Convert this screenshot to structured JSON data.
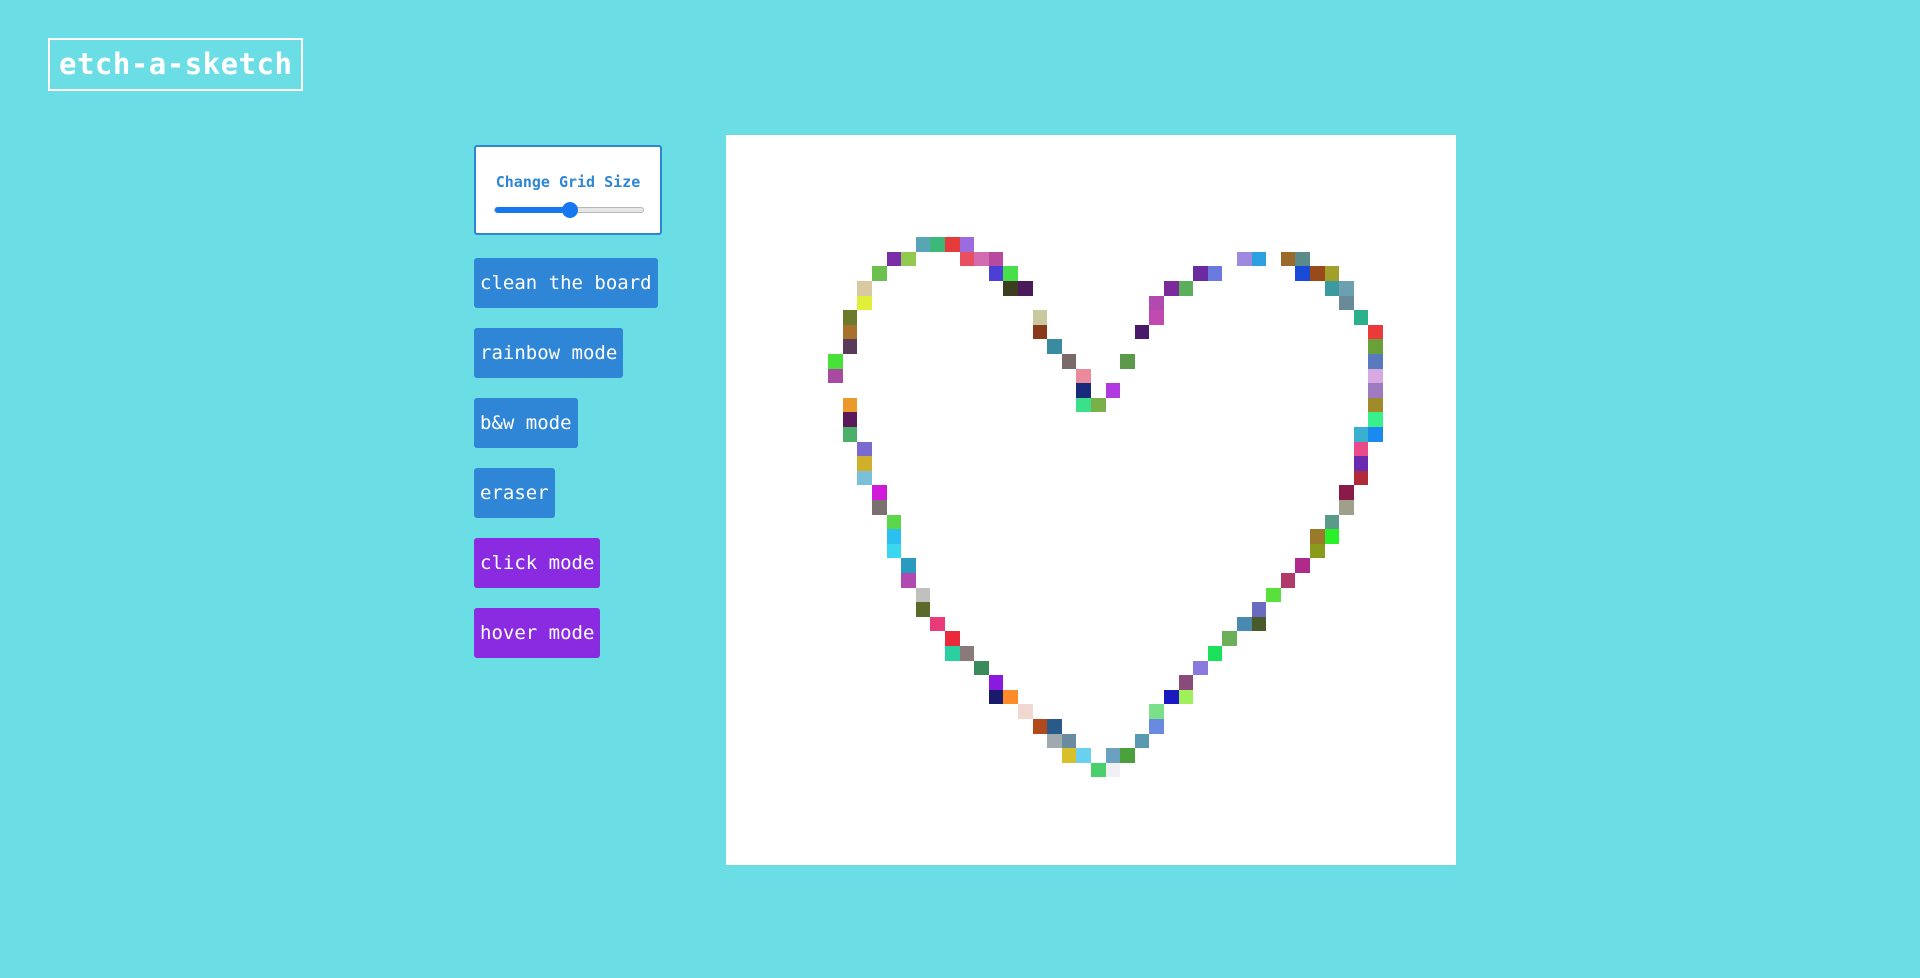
{
  "app": {
    "title": "etch-a-sketch"
  },
  "controls": {
    "grid_size_label": "Change Grid Size",
    "grid_size_slider_fraction": 0.5,
    "buttons": {
      "clean": "clean the board",
      "rainbow": "rainbow mode",
      "bw": "b&w mode",
      "eraser": "eraser",
      "click": "click mode",
      "hover": "hover mode"
    }
  },
  "colors": {
    "page_background": "#6adde5",
    "primary_button": "#2f86d6",
    "mode_button": "#8a2be2",
    "board_background": "#ffffff"
  },
  "board": {
    "grid_size": 50,
    "painted_cells": [
      {
        "c": 13,
        "r": 7,
        "color": "#5aa5b5"
      },
      {
        "c": 14,
        "r": 7,
        "color": "#3cb878"
      },
      {
        "c": 15,
        "r": 7,
        "color": "#e53b3b"
      },
      {
        "c": 16,
        "r": 7,
        "color": "#9c6be0"
      },
      {
        "c": 11,
        "r": 8,
        "color": "#7a2fa8"
      },
      {
        "c": 12,
        "r": 8,
        "color": "#93c94f"
      },
      {
        "c": 16,
        "r": 8,
        "color": "#ea4f5f"
      },
      {
        "c": 17,
        "r": 8,
        "color": "#d36bb0"
      },
      {
        "c": 18,
        "r": 8,
        "color": "#b54aa0"
      },
      {
        "c": 10,
        "r": 9,
        "color": "#6cc04f"
      },
      {
        "c": 18,
        "r": 9,
        "color": "#4b3fd8"
      },
      {
        "c": 19,
        "r": 9,
        "color": "#48e04a"
      },
      {
        "c": 9,
        "r": 10,
        "color": "#d9c9a0"
      },
      {
        "c": 19,
        "r": 10,
        "color": "#3d3d20"
      },
      {
        "c": 20,
        "r": 10,
        "color": "#4a1a5a"
      },
      {
        "c": 9,
        "r": 11,
        "color": "#e0f03a"
      },
      {
        "c": 8,
        "r": 12,
        "color": "#6b7a2a"
      },
      {
        "c": 21,
        "r": 12,
        "color": "#c9c9a0"
      },
      {
        "c": 8,
        "r": 13,
        "color": "#a8702a"
      },
      {
        "c": 21,
        "r": 13,
        "color": "#8a3a1a"
      },
      {
        "c": 8,
        "r": 14,
        "color": "#5a3a5a"
      },
      {
        "c": 22,
        "r": 14,
        "color": "#3a8aa0"
      },
      {
        "c": 7,
        "r": 15,
        "color": "#4ae03a"
      },
      {
        "c": 23,
        "r": 15,
        "color": "#7a6a6a"
      },
      {
        "c": 27,
        "r": 15,
        "color": "#5a9a4a"
      },
      {
        "c": 7,
        "r": 16,
        "color": "#a84aa0"
      },
      {
        "c": 24,
        "r": 16,
        "color": "#ea8a9a"
      },
      {
        "c": 24,
        "r": 17,
        "color": "#1a2a7a"
      },
      {
        "c": 26,
        "r": 17,
        "color": "#b03ae0"
      },
      {
        "c": 8,
        "r": 18,
        "color": "#ea9a2a"
      },
      {
        "c": 24,
        "r": 18,
        "color": "#3ae08a"
      },
      {
        "c": 25,
        "r": 18,
        "color": "#7ab04a"
      },
      {
        "c": 8,
        "r": 19,
        "color": "#5a1a5a"
      },
      {
        "c": 8,
        "r": 20,
        "color": "#4ab06a"
      },
      {
        "c": 9,
        "r": 21,
        "color": "#7a6ad0"
      },
      {
        "c": 9,
        "r": 22,
        "color": "#d0b02a"
      },
      {
        "c": 9,
        "r": 23,
        "color": "#7ac0d8"
      },
      {
        "c": 10,
        "r": 24,
        "color": "#d01ad8"
      },
      {
        "c": 10,
        "r": 25,
        "color": "#7a7070"
      },
      {
        "c": 11,
        "r": 26,
        "color": "#5ad84a"
      },
      {
        "c": 11,
        "r": 27,
        "color": "#2ac0f0"
      },
      {
        "c": 11,
        "r": 28,
        "color": "#3ad8f0"
      },
      {
        "c": 12,
        "r": 29,
        "color": "#2a9ac0"
      },
      {
        "c": 12,
        "r": 30,
        "color": "#b04ab0"
      },
      {
        "c": 13,
        "r": 31,
        "color": "#c0c0c0"
      },
      {
        "c": 13,
        "r": 32,
        "color": "#5a6a2a"
      },
      {
        "c": 14,
        "r": 33,
        "color": "#ea3a7a"
      },
      {
        "c": 15,
        "r": 34,
        "color": "#ea2a3a"
      },
      {
        "c": 15,
        "r": 35,
        "color": "#2ad0a0"
      },
      {
        "c": 16,
        "r": 35,
        "color": "#8a7a7a"
      },
      {
        "c": 17,
        "r": 36,
        "color": "#3a8a5a"
      },
      {
        "c": 18,
        "r": 37,
        "color": "#8a1ae0"
      },
      {
        "c": 18,
        "r": 38,
        "color": "#1a1a6a"
      },
      {
        "c": 19,
        "r": 38,
        "color": "#ff8a2a"
      },
      {
        "c": 20,
        "r": 39,
        "color": "#f0d8d0"
      },
      {
        "c": 21,
        "r": 40,
        "color": "#b04a1a"
      },
      {
        "c": 22,
        "r": 40,
        "color": "#2a5a8a"
      },
      {
        "c": 22,
        "r": 41,
        "color": "#a0a8b0"
      },
      {
        "c": 23,
        "r": 41,
        "color": "#6a8aa0"
      },
      {
        "c": 23,
        "r": 42,
        "color": "#d8c02a"
      },
      {
        "c": 24,
        "r": 42,
        "color": "#6ad0f0"
      },
      {
        "c": 26,
        "r": 42,
        "color": "#6aa0c0"
      },
      {
        "c": 27,
        "r": 42,
        "color": "#4aa03a"
      },
      {
        "c": 25,
        "r": 43,
        "color": "#4ad06a"
      },
      {
        "c": 26,
        "r": 43,
        "color": "#f0f0f4"
      },
      {
        "c": 28,
        "r": 41,
        "color": "#5a9ab0"
      },
      {
        "c": 29,
        "r": 40,
        "color": "#6a8ae0"
      },
      {
        "c": 29,
        "r": 39,
        "color": "#7ae08a"
      },
      {
        "c": 30,
        "r": 38,
        "color": "#1a1ac0"
      },
      {
        "c": 31,
        "r": 38,
        "color": "#a0f05a"
      },
      {
        "c": 31,
        "r": 37,
        "color": "#8a4a7a"
      },
      {
        "c": 32,
        "r": 36,
        "color": "#8a7ae0"
      },
      {
        "c": 33,
        "r": 35,
        "color": "#1ae05a"
      },
      {
        "c": 34,
        "r": 34,
        "color": "#6ab05a"
      },
      {
        "c": 35,
        "r": 33,
        "color": "#4a8ab0"
      },
      {
        "c": 36,
        "r": 33,
        "color": "#4a5a2a"
      },
      {
        "c": 36,
        "r": 32,
        "color": "#6a6ac0"
      },
      {
        "c": 37,
        "r": 31,
        "color": "#5ae03a"
      },
      {
        "c": 38,
        "r": 30,
        "color": "#b03a6a"
      },
      {
        "c": 39,
        "r": 29,
        "color": "#b02a8a"
      },
      {
        "c": 40,
        "r": 28,
        "color": "#8a9a1a"
      },
      {
        "c": 40,
        "r": 27,
        "color": "#9a7a2a"
      },
      {
        "c": 41,
        "r": 27,
        "color": "#2af02a"
      },
      {
        "c": 41,
        "r": 26,
        "color": "#5a9a8a"
      },
      {
        "c": 42,
        "r": 25,
        "color": "#a0a08a"
      },
      {
        "c": 42,
        "r": 24,
        "color": "#8a1a4a"
      },
      {
        "c": 43,
        "r": 23,
        "color": "#b02a3a"
      },
      {
        "c": 43,
        "r": 22,
        "color": "#6a2ab0"
      },
      {
        "c": 43,
        "r": 21,
        "color": "#ea4a8a"
      },
      {
        "c": 43,
        "r": 20,
        "color": "#3ab0d0"
      },
      {
        "c": 44,
        "r": 20,
        "color": "#1a8af0"
      },
      {
        "c": 44,
        "r": 19,
        "color": "#3af08a"
      },
      {
        "c": 44,
        "r": 18,
        "color": "#a08a2a"
      },
      {
        "c": 44,
        "r": 17,
        "color": "#a07ac0"
      },
      {
        "c": 44,
        "r": 16,
        "color": "#d8a8e0"
      },
      {
        "c": 44,
        "r": 15,
        "color": "#5a7ac0"
      },
      {
        "c": 44,
        "r": 14,
        "color": "#6aa03a"
      },
      {
        "c": 44,
        "r": 13,
        "color": "#ea3a3a"
      },
      {
        "c": 43,
        "r": 12,
        "color": "#2ab08a"
      },
      {
        "c": 42,
        "r": 11,
        "color": "#6a8a9a"
      },
      {
        "c": 42,
        "r": 10,
        "color": "#6aa0b0"
      },
      {
        "c": 41,
        "r": 10,
        "color": "#3a9aa0"
      },
      {
        "c": 41,
        "r": 9,
        "color": "#a0a02a"
      },
      {
        "c": 40,
        "r": 9,
        "color": "#9a4a1a"
      },
      {
        "c": 39,
        "r": 9,
        "color": "#1a4ad8"
      },
      {
        "c": 39,
        "r": 8,
        "color": "#5a8a8a"
      },
      {
        "c": 38,
        "r": 8,
        "color": "#9a6a2a"
      },
      {
        "c": 36,
        "r": 8,
        "color": "#2aa0e0"
      },
      {
        "c": 35,
        "r": 8,
        "color": "#a08ae0"
      },
      {
        "c": 33,
        "r": 9,
        "color": "#6a7ae0"
      },
      {
        "c": 32,
        "r": 9,
        "color": "#6a2aa0"
      },
      {
        "c": 31,
        "r": 10,
        "color": "#5ab05a"
      },
      {
        "c": 30,
        "r": 10,
        "color": "#7a2a9a"
      },
      {
        "c": 29,
        "r": 11,
        "color": "#b04ab0"
      },
      {
        "c": 29,
        "r": 12,
        "color": "#c04ab0"
      },
      {
        "c": 28,
        "r": 13,
        "color": "#4a1a6a"
      }
    ]
  }
}
